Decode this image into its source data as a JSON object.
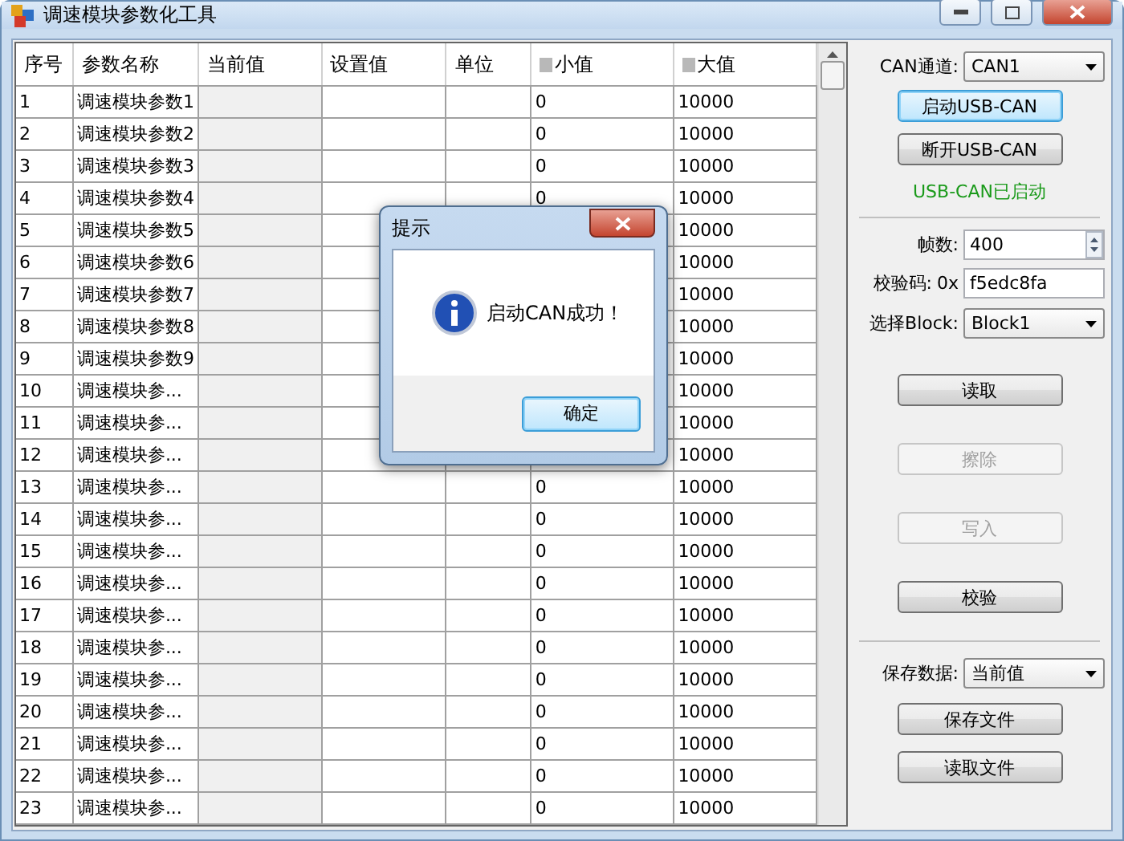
{
  "window": {
    "title": "调速模块参数化工具"
  },
  "table": {
    "columns": [
      {
        "label": "序号",
        "smudged": false
      },
      {
        "label": "参数名称",
        "smudged": false
      },
      {
        "label": "当前值",
        "smudged": false
      },
      {
        "label": "设置值",
        "smudged": false
      },
      {
        "label": "单位",
        "smudged": false
      },
      {
        "label": "小值",
        "smudged": true
      },
      {
        "label": "大值",
        "smudged": true
      }
    ],
    "rows": [
      {
        "index": "1",
        "name": "调速模块参数1",
        "min": "0",
        "max": "10000"
      },
      {
        "index": "2",
        "name": "调速模块参数2",
        "min": "0",
        "max": "10000"
      },
      {
        "index": "3",
        "name": "调速模块参数3",
        "min": "0",
        "max": "10000"
      },
      {
        "index": "4",
        "name": "调速模块参数4",
        "min": "0",
        "max": "10000"
      },
      {
        "index": "5",
        "name": "调速模块参数5",
        "max": "10000"
      },
      {
        "index": "6",
        "name": "调速模块参数6",
        "max": "10000"
      },
      {
        "index": "7",
        "name": "调速模块参数7",
        "max": "10000"
      },
      {
        "index": "8",
        "name": "调速模块参数8",
        "max": "10000"
      },
      {
        "index": "9",
        "name": "调速模块参数9",
        "max": "10000"
      },
      {
        "index": "10",
        "name": "调速模块参...",
        "max": "10000"
      },
      {
        "index": "11",
        "name": "调速模块参...",
        "max": "10000"
      },
      {
        "index": "12",
        "name": "调速模块参...",
        "max": "10000"
      },
      {
        "index": "13",
        "name": "调速模块参...",
        "min": "0",
        "max": "10000"
      },
      {
        "index": "14",
        "name": "调速模块参...",
        "min": "0",
        "max": "10000"
      },
      {
        "index": "15",
        "name": "调速模块参...",
        "min": "0",
        "max": "10000"
      },
      {
        "index": "16",
        "name": "调速模块参...",
        "min": "0",
        "max": "10000"
      },
      {
        "index": "17",
        "name": "调速模块参...",
        "min": "0",
        "max": "10000"
      },
      {
        "index": "18",
        "name": "调速模块参...",
        "min": "0",
        "max": "10000"
      },
      {
        "index": "19",
        "name": "调速模块参...",
        "min": "0",
        "max": "10000"
      },
      {
        "index": "20",
        "name": "调速模块参...",
        "min": "0",
        "max": "10000"
      },
      {
        "index": "21",
        "name": "调速模块参...",
        "min": "0",
        "max": "10000"
      },
      {
        "index": "22",
        "name": "调速模块参...",
        "min": "0",
        "max": "10000"
      },
      {
        "index": "23",
        "name": "调速模块参...",
        "min": "0",
        "max": "10000"
      }
    ]
  },
  "panel": {
    "channel": {
      "label": "CAN通道:",
      "value": "CAN1"
    },
    "connect_buttons": [
      {
        "label": "启动USB-CAN",
        "focused": true,
        "disabled": false
      },
      {
        "label": "断开USB-CAN",
        "focused": false,
        "disabled": false
      }
    ],
    "status": "USB-CAN已启动",
    "frames": {
      "label": "帧数:",
      "value": "400"
    },
    "checksum": {
      "label": "校验码:",
      "prefix": "0x",
      "value": "f5edc8fa"
    },
    "block": {
      "label": "选择Block:",
      "value": "Block1"
    },
    "actions": [
      {
        "label": "读取",
        "disabled": false
      },
      {
        "label": "擦除",
        "disabled": true
      },
      {
        "label": "写入",
        "disabled": true
      },
      {
        "label": "校验",
        "disabled": false
      }
    ],
    "save": {
      "label": "保存数据:",
      "value": "当前值"
    },
    "file_buttons": [
      {
        "label": "保存文件",
        "disabled": false
      },
      {
        "label": "读取文件",
        "disabled": false
      }
    ]
  },
  "dialog": {
    "title": "提示",
    "message": "启动CAN成功！",
    "button": {
      "label": "确定",
      "focused": true
    }
  }
}
